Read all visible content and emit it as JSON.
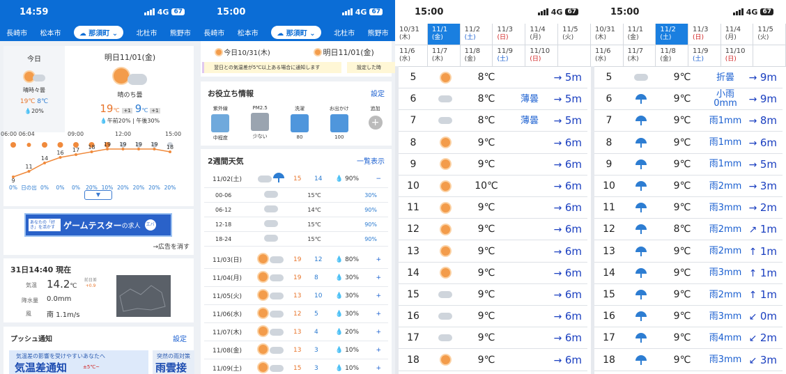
{
  "p1": {
    "time": "14:59",
    "net": "4G",
    "batt": "67",
    "cities": [
      "長崎市",
      "松本市",
      "那須町",
      "北杜市",
      "熊野市"
    ],
    "today": {
      "label": "今日",
      "desc": "晴時々曇",
      "hi": "19",
      "hiu": "℃",
      "lo": "8",
      "lou": "℃",
      "pop": "20%"
    },
    "tomorrow": {
      "label": "明日11/01(金)",
      "desc": "晴のち曇",
      "hi": "19",
      "hiu": "℃",
      "hid": "+1",
      "lo": "9",
      "lou": "℃",
      "lod": "+1",
      "pop": "午前20% | 午後30%"
    },
    "timeline": [
      "06:00 06:04",
      "09:00",
      "12:00",
      "15:00"
    ],
    "temps": [
      "9",
      "11",
      "14",
      "16",
      "17",
      "18",
      "19",
      "19",
      "19",
      "19",
      "18"
    ],
    "pops": [
      "0%",
      "日の出",
      "0%",
      "0%",
      "0%",
      "20%",
      "10%",
      "20%",
      "20%",
      "20%",
      "20%"
    ],
    "ad": {
      "title": "ゲームテスター",
      "suffix": "の求人",
      "badge": "あなたの「好き」を活かす",
      "logo": "エバ",
      "close": "→広告を消す"
    },
    "now": {
      "title": "31日14:40 現在",
      "temp_label": "気温",
      "temp": "14.2",
      "temp_unit": "℃",
      "diff_label": "前日差",
      "diff": "+0.9",
      "rain_label": "降水量",
      "rain": "0.0mm",
      "wind_label": "風",
      "wind": "南 1.1m/s"
    },
    "push": {
      "title": "プッシュ通知",
      "setting": "設定",
      "ad1": "気温差の影響を受けやすいあなたへ",
      "ad1_big": "気温差通知",
      "ad1_temp": "±5℃~",
      "ad2": "突然の雨対策",
      "ad2_big": "雨雲接"
    }
  },
  "p2": {
    "time": "15:00",
    "net": "4G",
    "batt": "67",
    "cities": [
      "長崎市",
      "松本市",
      "那須町",
      "北杜市",
      "熊野市"
    ],
    "date_today": "今日10/31(木)",
    "date_tom": "明日11/01(金)",
    "banner1": "翌日との気温差が5℃以上ある場合に通知します",
    "banner2": "設定した時",
    "useful": {
      "title": "お役立ち情報",
      "setting": "設定",
      "items": [
        {
          "label": "紫外線",
          "value": "中程度"
        },
        {
          "label": "PM2.5",
          "value": "少ない"
        },
        {
          "label": "洗濯",
          "value": "80"
        },
        {
          "label": "お出かけ",
          "value": "100"
        },
        {
          "label": "追加",
          "value": ""
        }
      ]
    },
    "week": {
      "title": "2週間天気",
      "more": "一覧表示",
      "first": {
        "date": "11/02(土)",
        "hi": "15",
        "lo": "14",
        "pop": "90%",
        "sign": "−"
      },
      "subs": [
        {
          "t": "00-06",
          "temp": "15℃",
          "pop": "30%"
        },
        {
          "t": "06-12",
          "temp": "14℃",
          "pop": "90%"
        },
        {
          "t": "12-18",
          "temp": "15℃",
          "pop": "90%"
        },
        {
          "t": "18-24",
          "temp": "15℃",
          "pop": "90%"
        }
      ],
      "rows": [
        {
          "date": "11/03(日)",
          "hi": "19",
          "lo": "12",
          "pop": "80%"
        },
        {
          "date": "11/04(月)",
          "hi": "19",
          "lo": "8",
          "pop": "30%"
        },
        {
          "date": "11/05(火)",
          "hi": "13",
          "lo": "10",
          "pop": "30%"
        },
        {
          "date": "11/06(水)",
          "hi": "12",
          "lo": "5",
          "pop": "30%"
        },
        {
          "date": "11/07(木)",
          "hi": "13",
          "lo": "4",
          "pop": "20%"
        },
        {
          "date": "11/08(金)",
          "hi": "13",
          "lo": "3",
          "pop": "10%"
        },
        {
          "date": "11/09(土)",
          "hi": "15",
          "lo": "3",
          "pop": "10%"
        }
      ]
    }
  },
  "p3": {
    "time": "15:00",
    "net": "4G",
    "batt": "67",
    "dates": [
      [
        "10/31",
        "(木)"
      ],
      [
        "11/1",
        "(金)"
      ],
      [
        "11/2",
        "(土)"
      ],
      [
        "11/3",
        "(日)"
      ],
      [
        "11/4",
        "(月)"
      ],
      [
        "11/5",
        "(火)"
      ],
      [
        "11/6",
        "(水)"
      ],
      [
        "11/7",
        "(木)"
      ],
      [
        "11/8",
        "(金)"
      ],
      [
        "11/9",
        "(土)"
      ],
      [
        "11/10",
        "(日)"
      ]
    ],
    "hours": [
      {
        "h": "5",
        "i": "sun",
        "t": "8℃",
        "w": "",
        "wind": "5m"
      },
      {
        "h": "6",
        "i": "cloud",
        "t": "8℃",
        "w": "薄曇",
        "wind": "5m"
      },
      {
        "h": "7",
        "i": "cloud",
        "t": "8℃",
        "w": "薄曇",
        "wind": "5m"
      },
      {
        "h": "8",
        "i": "sun",
        "t": "9℃",
        "w": "",
        "wind": "6m"
      },
      {
        "h": "9",
        "i": "sun",
        "t": "9℃",
        "w": "",
        "wind": "6m"
      },
      {
        "h": "10",
        "i": "sun",
        "t": "10℃",
        "w": "",
        "wind": "6m"
      },
      {
        "h": "11",
        "i": "sun",
        "t": "9℃",
        "w": "",
        "wind": "6m"
      },
      {
        "h": "12",
        "i": "sun",
        "t": "9℃",
        "w": "",
        "wind": "6m"
      },
      {
        "h": "13",
        "i": "sun",
        "t": "9℃",
        "w": "",
        "wind": "6m"
      },
      {
        "h": "14",
        "i": "sun",
        "t": "9℃",
        "w": "",
        "wind": "6m"
      },
      {
        "h": "15",
        "i": "cloud",
        "t": "9℃",
        "w": "",
        "wind": "6m"
      },
      {
        "h": "16",
        "i": "cloud",
        "t": "9℃",
        "w": "",
        "wind": "6m"
      },
      {
        "h": "17",
        "i": "cloud",
        "t": "9℃",
        "w": "",
        "wind": "6m"
      },
      {
        "h": "18",
        "i": "sun",
        "t": "9℃",
        "w": "",
        "wind": "6m"
      }
    ]
  },
  "p4": {
    "time": "15:00",
    "net": "4G",
    "batt": "67",
    "dates": [
      [
        "10/31",
        "(木)"
      ],
      [
        "11/1",
        "(金)"
      ],
      [
        "11/2",
        "(土)"
      ],
      [
        "11/3",
        "(日)"
      ],
      [
        "11/4",
        "(月)"
      ],
      [
        "11/5",
        "(火)"
      ],
      [
        "11/6",
        "(水)"
      ],
      [
        "11/7",
        "(木)"
      ],
      [
        "11/8",
        "(金)"
      ],
      [
        "11/9",
        "(土)"
      ],
      [
        "11/10",
        "(日)"
      ]
    ],
    "hours": [
      {
        "h": "5",
        "i": "cloud",
        "t": "9℃",
        "w": "折曇",
        "wind": "9m",
        "a": "→"
      },
      {
        "h": "6",
        "i": "umb",
        "t": "9℃",
        "w": "小雨",
        "w2": "0mm",
        "wind": "9m",
        "a": "→"
      },
      {
        "h": "7",
        "i": "umb",
        "t": "9℃",
        "w": "雨1mm",
        "wind": "8m",
        "a": "→"
      },
      {
        "h": "8",
        "i": "umb",
        "t": "9℃",
        "w": "雨1mm",
        "wind": "6m",
        "a": "→"
      },
      {
        "h": "9",
        "i": "umb",
        "t": "9℃",
        "w": "雨1mm",
        "wind": "5m",
        "a": "→"
      },
      {
        "h": "10",
        "i": "umb",
        "t": "9℃",
        "w": "雨2mm",
        "wind": "3m",
        "a": "→"
      },
      {
        "h": "11",
        "i": "umb",
        "t": "9℃",
        "w": "雨3mm",
        "wind": "2m",
        "a": "→"
      },
      {
        "h": "12",
        "i": "umb",
        "t": "8℃",
        "w": "雨2mm",
        "wind": "1m",
        "a": "↗"
      },
      {
        "h": "13",
        "i": "umb",
        "t": "9℃",
        "w": "雨2mm",
        "wind": "1m",
        "a": "↑"
      },
      {
        "h": "14",
        "i": "umb",
        "t": "9℃",
        "w": "雨3mm",
        "wind": "1m",
        "a": "↑"
      },
      {
        "h": "15",
        "i": "umb",
        "t": "9℃",
        "w": "雨2mm",
        "wind": "1m",
        "a": "↑"
      },
      {
        "h": "16",
        "i": "umb",
        "t": "9℃",
        "w": "雨3mm",
        "wind": "0m",
        "a": "↙"
      },
      {
        "h": "17",
        "i": "umb",
        "t": "9℃",
        "w": "雨4mm",
        "wind": "2m",
        "a": "↙"
      },
      {
        "h": "18",
        "i": "umb",
        "t": "9℃",
        "w": "雨3mm",
        "wind": "3m",
        "a": "↙"
      }
    ]
  }
}
